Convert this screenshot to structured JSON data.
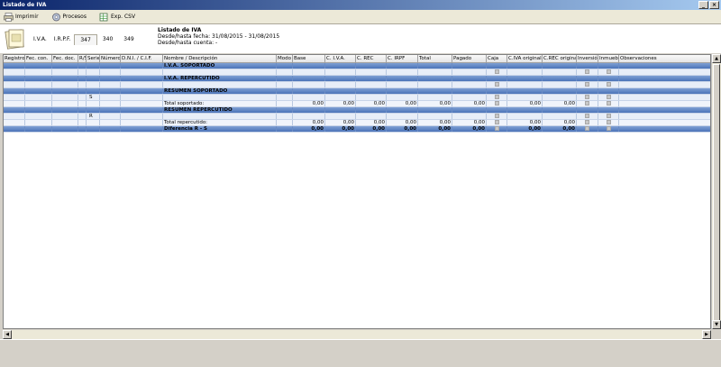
{
  "window": {
    "title": "Listado de IVA"
  },
  "toolbar": {
    "print_label": "Imprimir",
    "process_label": "Procesos",
    "export_label": "Exp. CSV"
  },
  "tabs": {
    "iva": "I.V.A.",
    "irpf": "I.R.P.F.",
    "n347": "347",
    "n340": "340",
    "n349": "349"
  },
  "header": {
    "title": "Listado de IVA",
    "fecha": "Desde/hasta fecha: 31/08/2015 - 31/08/2015",
    "cuenta": "Desde/hasta cuenta: -"
  },
  "columns": {
    "registro": "Registro",
    "fec_con": "Fec. con.",
    "fec_doc": "Fec. doc.",
    "rs": "R/S",
    "serie": "Serie",
    "numero": "Número",
    "dni": "D.N.I. / C.I.F.",
    "nombre": "Nombre / Descripción",
    "modo": "Modo",
    "base": "Base",
    "civa": "C. I.V.A.",
    "crec": "C. REC",
    "cirpf": "C. IRPF",
    "total": "Total",
    "pagado": "Pagado",
    "caja": "Caja",
    "civa_orig": "C.IVA original",
    "crec_orig": "C.REC original",
    "inversion": "Inversión",
    "inmueble": "Inmueble",
    "observaciones": "Observaciones"
  },
  "rows": {
    "iva_soportado": "I.V.A. SOPORTADO",
    "iva_repercutido": "I.V.A. REPERCUTIDO",
    "resumen_soportado": "RESUMEN SOPORTADO",
    "s_code": "S",
    "total_soportado": "Total soportado:",
    "resumen_repercutido": "RESUMEN REPERCUTIDO",
    "r_code": "R",
    "total_repercutido": "Total repercutido:",
    "diferencia": "Diferencia R - S",
    "zero": "0,00"
  }
}
